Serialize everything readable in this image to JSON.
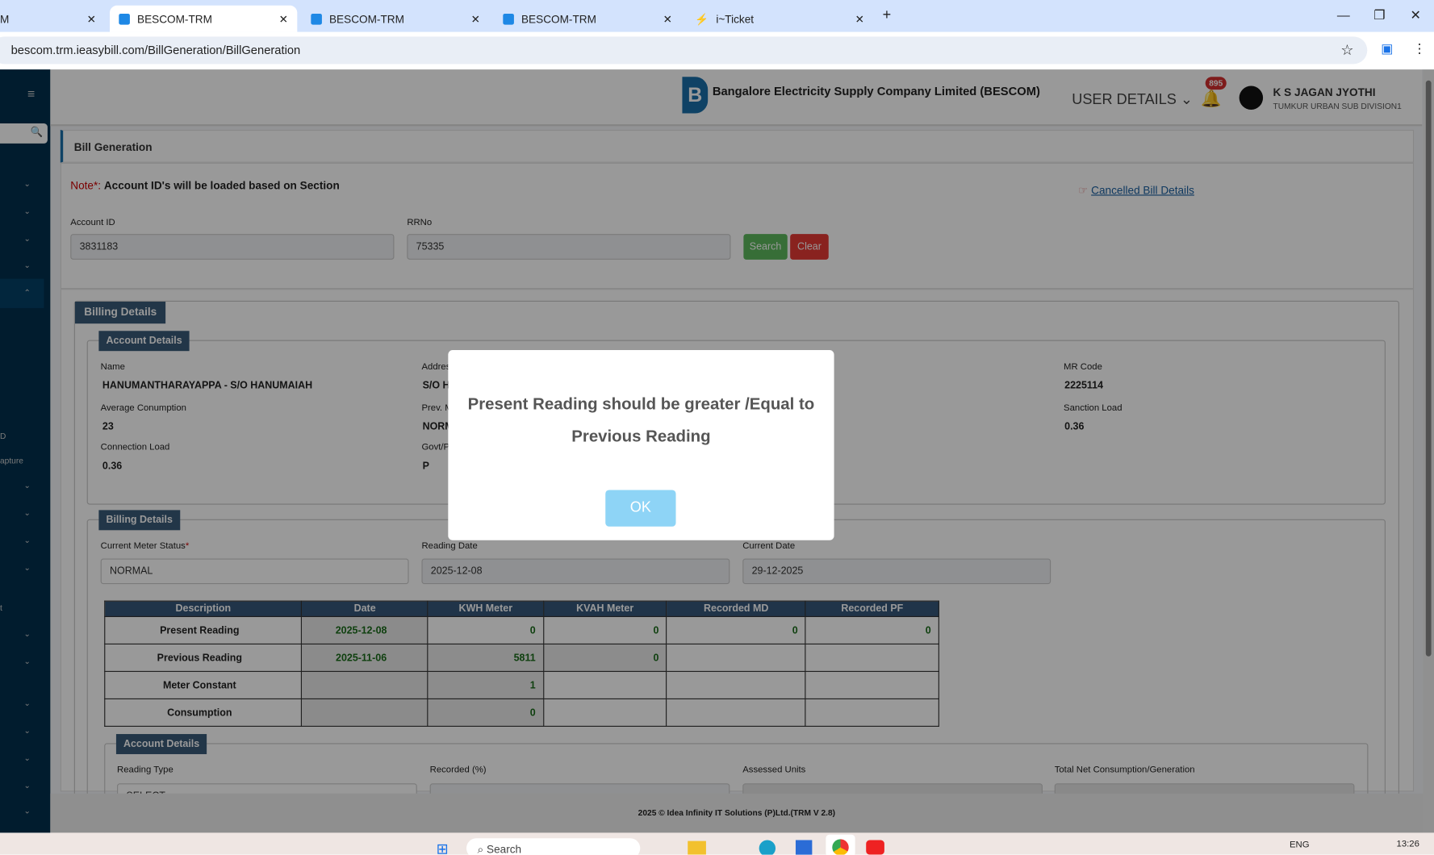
{
  "browser": {
    "tabs": [
      {
        "title": "M"
      },
      {
        "title": "BESCOM-TRM"
      },
      {
        "title": "BESCOM-TRM"
      },
      {
        "title": "BESCOM-TRM"
      },
      {
        "title": "i~Ticket"
      }
    ],
    "url": "bescom.trm.ieasybill.com/BillGeneration/BillGeneration"
  },
  "header": {
    "company": "Bangalore Electricity Supply Company Limited (BESCOM)",
    "logo_text": "BESCOM",
    "user_details": "USER DETAILS",
    "notifications": "895",
    "user_name": "K S JAGAN JYOTHI",
    "user_division": "TUMKUR URBAN SUB DIVISION1"
  },
  "sidebar": {
    "partial_labels": [
      "D",
      "apture",
      "t"
    ]
  },
  "page": {
    "title": "Bill Generation",
    "note_prefix": "Note*:",
    "note": "Account ID's will be loaded based on Section",
    "cancelled_link": "Cancelled Bill Details",
    "account_id_label": "Account ID",
    "account_id": "3831183",
    "rrno_label": "RRNo",
    "rrno": "75335",
    "search": "Search",
    "clear": "Clear"
  },
  "billing": {
    "title": "Billing Details",
    "account_title": "Account Details",
    "fields": [
      {
        "label": "Name",
        "value": "HANUMANTHARAYAPPA - S/O HANUMAIAH"
      },
      {
        "label": "Addres",
        "value": "S/O H"
      },
      {
        "label": "MR Code",
        "value": "2225114"
      },
      {
        "label": "Average Conumption",
        "value": "23"
      },
      {
        "label": "Prev. M",
        "value": "NORM"
      },
      {
        "label": "Sanction Load",
        "value": "0.36"
      },
      {
        "label": "Connection Load",
        "value": "0.36"
      },
      {
        "label": "Govt/P",
        "value": "P"
      }
    ],
    "billing_title": "Billing Details",
    "meter_status_label": "Current Meter Status",
    "meter_status": "NORMAL",
    "reading_date_label": "Reading Date",
    "reading_date": "2025-12-08",
    "current_date_label": "Current Date",
    "current_date": "29-12-2025",
    "table": {
      "headers": [
        "Description",
        "Date",
        "KWH Meter",
        "KVAH Meter",
        "Recorded MD",
        "Recorded PF"
      ],
      "rows": [
        [
          "Present Reading",
          "2025-12-08",
          "0",
          "0",
          "0",
          "0"
        ],
        [
          "Previous Reading",
          "2025-11-06",
          "5811",
          "0",
          "",
          ""
        ],
        [
          "Meter Constant",
          "",
          "1",
          "",
          "",
          ""
        ],
        [
          "Consumption",
          "",
          "0",
          "",
          "",
          ""
        ]
      ]
    },
    "account2_title": "Account Details",
    "reading_type_label": "Reading Type",
    "reading_type": "SELECT",
    "recorded_label": "Recorded (%)",
    "assessed_label": "Assessed Units",
    "total_label": "Total Net Consumption/Generation"
  },
  "footer": "2025 © Idea Infinity IT Solutions (P)Ltd.(TRM V 2.8)",
  "modal": {
    "line1": "Present Reading should be greater /Equal to",
    "line2": "Previous Reading",
    "ok": "OK"
  },
  "taskbar": {
    "search": "Search",
    "lang": "ENG",
    "time": "13:26"
  }
}
